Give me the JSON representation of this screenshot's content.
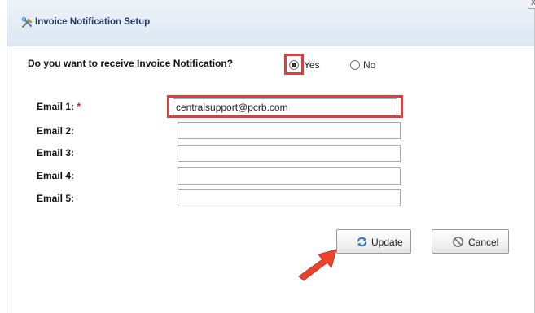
{
  "dialog": {
    "title": "Invoice Notification Setup",
    "title_icon": "tools-icon",
    "close_label": "X"
  },
  "question": {
    "text": "Do you want to receive Invoice Notification?",
    "yes_label": "Yes",
    "no_label": "No",
    "selected": "Yes"
  },
  "emails": [
    {
      "label": "Email 1:",
      "required_mark": "*",
      "value": "centralsupport@pcrb.com"
    },
    {
      "label": "Email 2:",
      "value": ""
    },
    {
      "label": "Email 3:",
      "value": ""
    },
    {
      "label": "Email 4:",
      "value": ""
    },
    {
      "label": "Email 5:",
      "value": ""
    }
  ],
  "buttons": {
    "update_label": "Update",
    "update_icon": "refresh-icon",
    "cancel_label": "Cancel",
    "cancel_icon": "cancel-icon"
  },
  "colors": {
    "highlight": "#d94040",
    "arrow": "#e8452e",
    "title_text": "#1f3b63"
  }
}
